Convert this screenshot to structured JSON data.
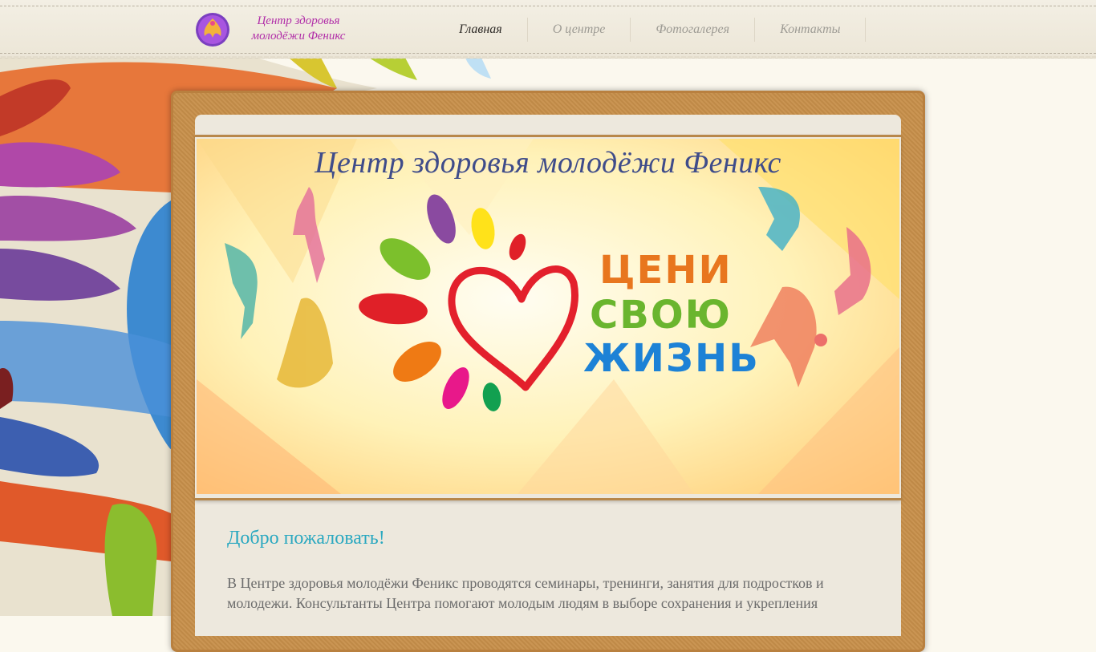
{
  "header": {
    "logo_text": "Центр здоровья молодёжи Феникс",
    "nav": [
      {
        "label": "Главная",
        "active": true
      },
      {
        "label": "О центре",
        "active": false
      },
      {
        "label": "Фотогалерея",
        "active": false
      },
      {
        "label": "Контакты",
        "active": false
      }
    ]
  },
  "banner": {
    "title": "Центр здоровья молодёжи Феникс",
    "slogan_1": "ЦЕНИ",
    "slogan_2": "СВОЮ",
    "slogan_3": "ЖИЗНЬ",
    "icons": [
      "heart-icon",
      "petal-icon",
      "dancer-silhouette-icon"
    ]
  },
  "content": {
    "heading": "Добро пожаловать!",
    "intro": "В Центре здоровья молодёжи Феникс проводятся семинары, тренинги, занятия для подростков и молодежи. Консультанты Центра помогают молодым людям в выборе сохранения и укрепления"
  },
  "colors": {
    "logo": "#b12ea8",
    "welcome": "#2aa8c0",
    "frame": "#c78f4a",
    "slogan_orange": "#e8761e",
    "slogan_green": "#6ab52e",
    "slogan_blue": "#1d82d6"
  }
}
